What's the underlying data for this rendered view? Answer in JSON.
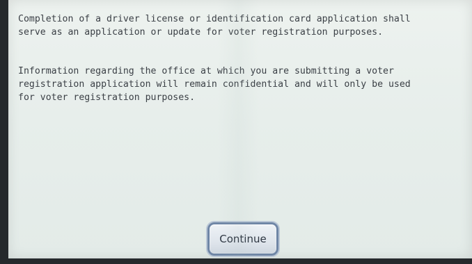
{
  "screen": {
    "paragraph_1": "Completion of a driver license or identification card application shall\nserve as an application or update for voter registration purposes.",
    "paragraph_2": "Information regarding the office at which you are submitting a voter\nregistration application will remain confidential and will only be used\nfor voter registration purposes.",
    "continue_label": "Continue"
  }
}
